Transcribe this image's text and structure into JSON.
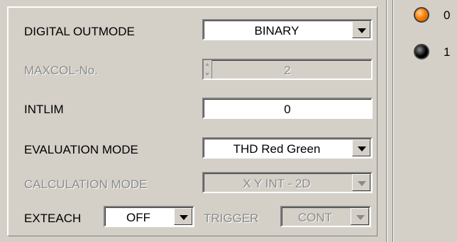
{
  "settings": {
    "digital_outmode": {
      "label": "DIGITAL OUTMODE",
      "value": "BINARY"
    },
    "maxcol": {
      "label": "MAXCOL-No.",
      "value": "2"
    },
    "intlim": {
      "label": "INTLIM",
      "value": "0"
    },
    "evaluation_mode": {
      "label": "EVALUATION MODE",
      "value": "THD Red Green"
    },
    "calculation_mode": {
      "label": "CALCULATION MODE",
      "value": "X Y INT - 2D"
    },
    "exteach": {
      "label": "EXTEACH",
      "value": "OFF"
    },
    "trigger": {
      "label": "TRIGGER",
      "value": "CONT"
    }
  },
  "indicators": [
    {
      "label": "0",
      "state": "on",
      "color": "#ff8000"
    },
    {
      "label": "1",
      "state": "off",
      "color": "#000000"
    }
  ],
  "colors": {
    "background": "#d4d0c8",
    "disabled_text": "#8a8a8a",
    "led_on": "#ff8000",
    "led_off": "#000000"
  }
}
